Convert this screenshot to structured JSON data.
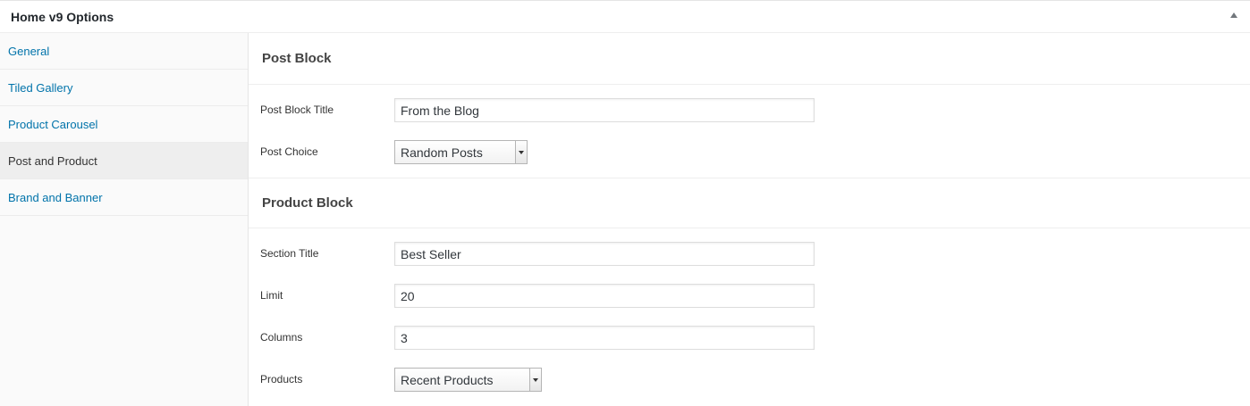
{
  "panel": {
    "title": "Home v9 Options",
    "toggle_icon": "collapse-arrow-icon"
  },
  "sidebar": {
    "items": [
      {
        "label": "General",
        "active": false
      },
      {
        "label": "Tiled Gallery",
        "active": false
      },
      {
        "label": "Product Carousel",
        "active": false
      },
      {
        "label": "Post and Product",
        "active": true
      },
      {
        "label": "Brand and Banner",
        "active": false
      }
    ]
  },
  "post_block": {
    "heading": "Post Block",
    "title_label": "Post Block Title",
    "title_value": "From the Blog",
    "choice_label": "Post Choice",
    "choice_value": "Random Posts"
  },
  "product_block": {
    "heading": "Product Block",
    "section_title_label": "Section Title",
    "section_title_value": "Best Seller",
    "limit_label": "Limit",
    "limit_value": "20",
    "columns_label": "Columns",
    "columns_value": "3",
    "products_label": "Products",
    "products_value": "Recent Products"
  },
  "colors": {
    "link": "#0073aa",
    "active_tab_bg": "#eeeeee",
    "sidebar_bg": "#fafafa"
  }
}
